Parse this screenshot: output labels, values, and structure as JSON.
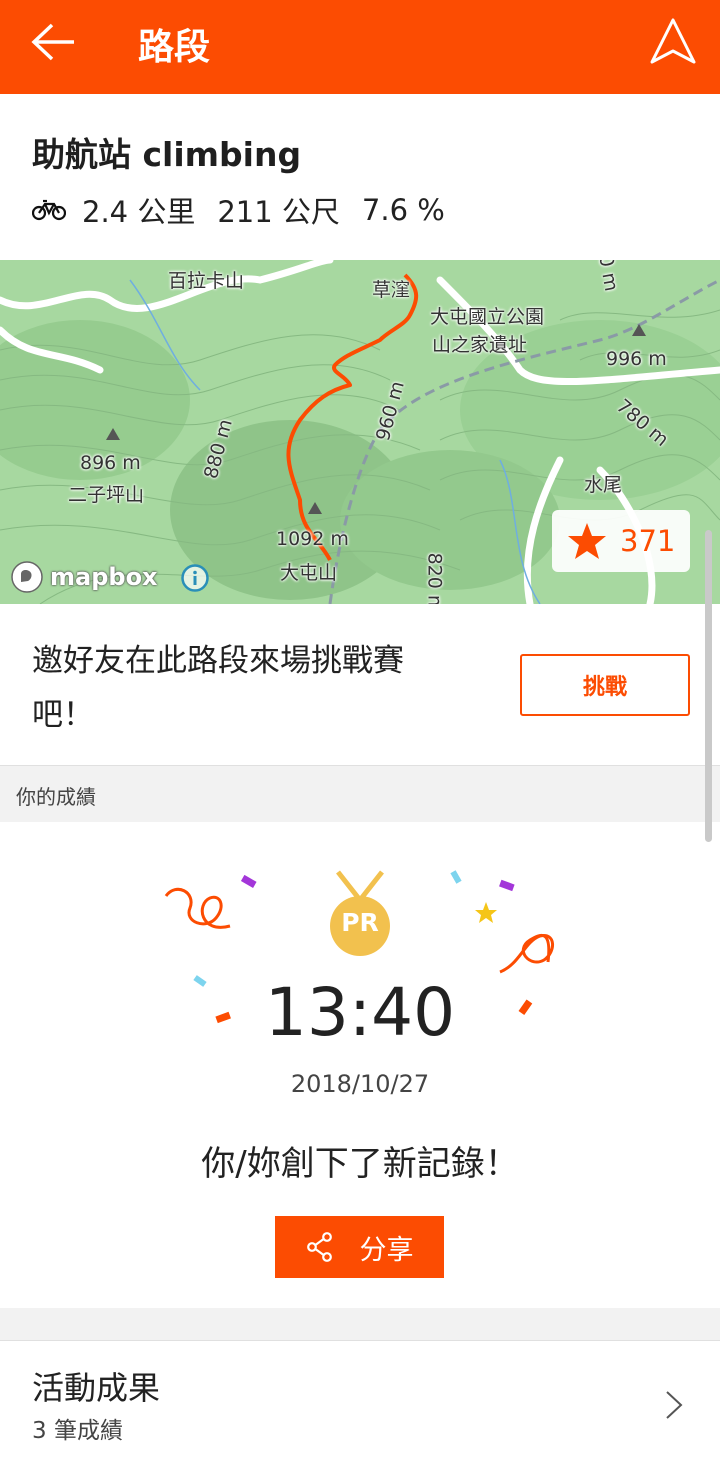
{
  "header": {
    "title": "路段",
    "back_icon": "arrow-left-icon",
    "nav_icon": "navigation-icon",
    "color": "#fc4c02"
  },
  "segment": {
    "name": "助航站 climbing",
    "sport_icon": "bike-icon",
    "distance": "2.4 公里",
    "elevation": "211 公尺",
    "grade": "7.6 %"
  },
  "map": {
    "labels": {
      "bailaka": "百拉卡山",
      "caowa": "草漥",
      "datun_park": "大屯國立公園",
      "mountain_house": "山之家遺址",
      "elev_996": "996 m",
      "elev_960": "960 m",
      "elev_780": "780 m",
      "elev_880": "880 m",
      "elev_896": "896 m",
      "erzipingshan": "二子坪山",
      "shuiwei": "水尾",
      "elev_1092": "1092 m",
      "datunshan": "大屯山",
      "elev_820": "820 m",
      "elev_top": "0 m"
    },
    "attribution": "mapbox",
    "star_count": "371"
  },
  "challenge": {
    "text": "邀好友在此路段來場挑戰賽吧！",
    "button_label": "挑戰"
  },
  "results": {
    "section_title": "你的成績",
    "badge": "PR",
    "time": "13:40",
    "date": "2018/10/27",
    "message": "你/妳創下了新記錄！",
    "share_label": "分享"
  },
  "activity": {
    "title": "活動成果",
    "subtitle": "3 筆成績"
  }
}
